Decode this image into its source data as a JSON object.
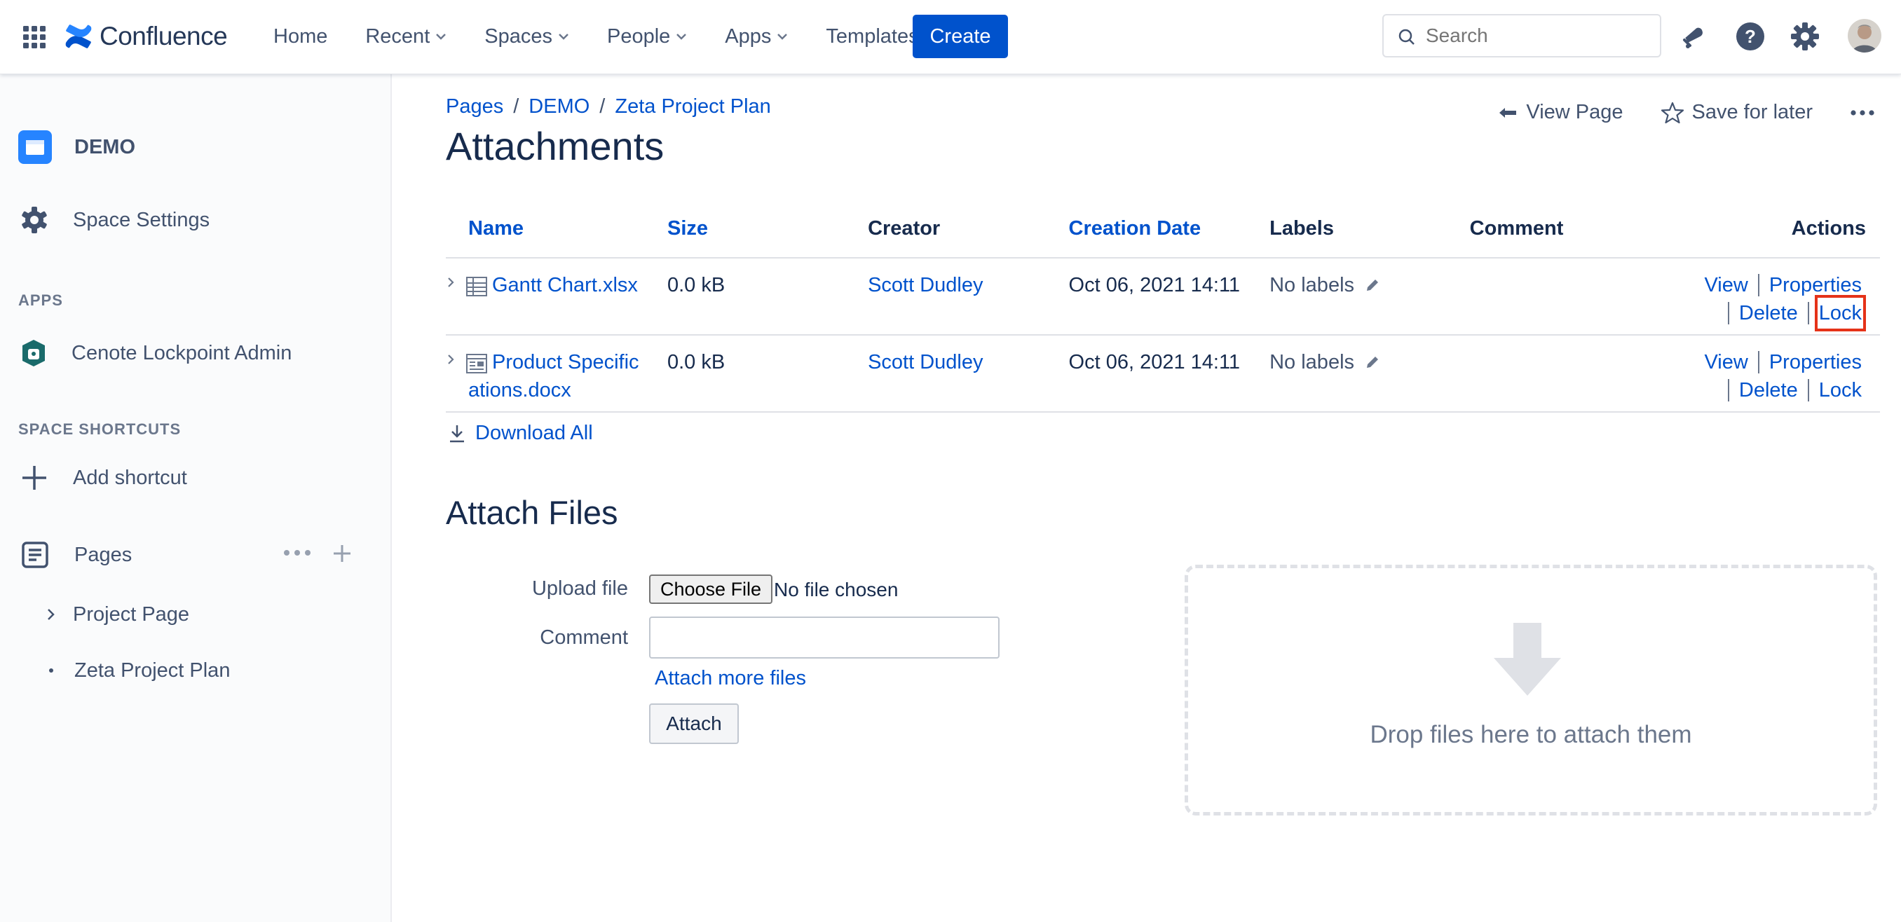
{
  "app": {
    "name": "Confluence"
  },
  "nav": {
    "home": "Home",
    "recent": "Recent",
    "spaces": "Spaces",
    "people": "People",
    "apps": "Apps",
    "templates": "Templates",
    "create": "Create"
  },
  "search": {
    "placeholder": "Search"
  },
  "icons": {
    "apps_grid": "grid-icon",
    "notifications": "bell-icon",
    "help": "help-icon",
    "settings": "gear-icon",
    "profile": "avatar"
  },
  "sidebar": {
    "space_name": "DEMO",
    "space_settings": "Space Settings",
    "apps_heading": "APPS",
    "apps_item": "Cenote Lockpoint Admin",
    "shortcuts_heading": "SPACE SHORTCUTS",
    "add_shortcut": "Add shortcut",
    "pages_label": "Pages",
    "page_items": [
      {
        "label": "Project Page"
      },
      {
        "label": "Zeta Project Plan"
      }
    ]
  },
  "breadcrumb": {
    "items": [
      "Pages",
      "DEMO",
      "Zeta Project Plan"
    ],
    "separator": "/"
  },
  "page": {
    "title": "Attachments",
    "view_page": "View Page",
    "save_for_later": "Save for later"
  },
  "table": {
    "headers": {
      "name": "Name",
      "size": "Size",
      "creator": "Creator",
      "creation_date": "Creation Date",
      "labels": "Labels",
      "comment": "Comment",
      "actions": "Actions"
    },
    "rows": [
      {
        "name_line1": "Gantt Chart.xlsx",
        "name_line2": "",
        "size": "0.0 kB",
        "creator": "Scott Dudley",
        "date": "Oct 06, 2021 14:11",
        "labels": "No labels",
        "comment": ""
      },
      {
        "name_line1": "Product Specific",
        "name_line2": "ations.docx",
        "size": "0.0 kB",
        "creator": "Scott Dudley",
        "date": "Oct 06, 2021 14:11",
        "labels": "No labels",
        "comment": ""
      }
    ],
    "actions": {
      "view": "View",
      "properties": "Properties",
      "delete": "Delete",
      "lock": "Lock"
    }
  },
  "download_all": "Download All",
  "attach": {
    "heading": "Attach Files",
    "upload_label": "Upload file",
    "choose_file": "Choose File",
    "file_status": "No file chosen",
    "comment_label": "Comment",
    "comment_value": "",
    "attach_more": "Attach more files",
    "attach_button": "Attach",
    "drop_text": "Drop files here to attach them"
  },
  "colors": {
    "brand": "#0052CC",
    "highlight": "#E53218",
    "sidebar_bg": "#FAFBFC"
  }
}
